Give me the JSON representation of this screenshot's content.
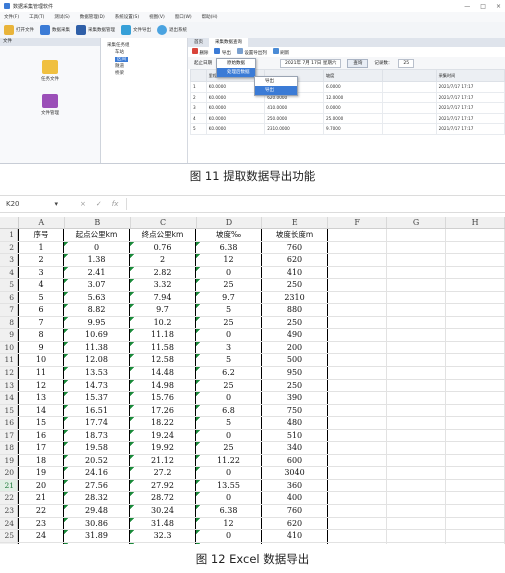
{
  "fig11": {
    "window_title": "数据采集管理软件",
    "window_controls": [
      "—",
      "□",
      "×"
    ],
    "menu": [
      "文件(F)",
      "工具(T)",
      "测试(S)",
      "数据管理(D)",
      "系统设置(S)",
      "视图(V)",
      "窗口(W)",
      "帮助(H)"
    ],
    "toolbar": [
      "打开文件",
      "数据采集",
      "采集数据管理",
      "文件导出",
      "退出系统"
    ],
    "left_panel_title": "文件",
    "left_items": [
      "任务文件",
      "文件管理"
    ],
    "tree": [
      "采集任务组",
      "车站",
      "区间",
      "隧道",
      "桥梁"
    ],
    "tabs": [
      "首页",
      "采集数据查询"
    ],
    "main_tools": [
      "删除",
      "导出",
      "设置导出列",
      "刷新"
    ],
    "filter": {
      "label": "起止日期",
      "date_to": "2021年 7月 17日 星期六",
      "query": "查询",
      "page_label": "记录数：",
      "page_value": "25"
    },
    "grid_columns": [
      "",
      "里程",
      "",
      "坡度",
      "",
      "采集时间"
    ],
    "grid_rows": [
      [
        "1",
        "K0.0000",
        "",
        "6.0000",
        "",
        "2021/7/17 17:17"
      ],
      [
        "2",
        "K0.0000",
        "620.0000",
        "12.0000",
        "",
        "2021/7/17 17:17"
      ],
      [
        "3",
        "K0.0000",
        "410.0000",
        "0.0000",
        "",
        "2021/7/17 17:17"
      ],
      [
        "4",
        "K0.0000",
        "250.0000",
        "25.0000",
        "",
        "2021/7/17 17:17"
      ],
      [
        "5",
        "K0.0000",
        "2310.0000",
        "9.7000",
        "",
        "2021/7/17 17:17"
      ]
    ],
    "context_menu": [
      "原始数据",
      "处理后数据"
    ],
    "submenu": [
      "导出",
      "导出"
    ],
    "caption": "图 11    提取数据导出功能"
  },
  "fig12": {
    "name_box": "K20",
    "fx": [
      "×",
      "✓",
      "fx"
    ],
    "columns": [
      "A",
      "B",
      "C",
      "D",
      "E",
      "F",
      "G",
      "H"
    ],
    "headers": [
      "序号",
      "起点公里km",
      "终点公里km",
      "坡度‰",
      "坡度长度m"
    ],
    "rows": [
      [
        "1",
        "0",
        "0.76",
        "6.38",
        "760"
      ],
      [
        "2",
        "1.38",
        "2",
        "12",
        "620"
      ],
      [
        "3",
        "2.41",
        "2.82",
        "0",
        "410"
      ],
      [
        "4",
        "3.07",
        "3.32",
        "25",
        "250"
      ],
      [
        "5",
        "5.63",
        "7.94",
        "9.7",
        "2310"
      ],
      [
        "6",
        "8.82",
        "9.7",
        "5",
        "880"
      ],
      [
        "7",
        "9.95",
        "10.2",
        "25",
        "250"
      ],
      [
        "8",
        "10.69",
        "11.18",
        "0",
        "490"
      ],
      [
        "9",
        "11.38",
        "11.58",
        "3",
        "200"
      ],
      [
        "10",
        "12.08",
        "12.58",
        "5",
        "500"
      ],
      [
        "11",
        "13.53",
        "14.48",
        "6.2",
        "950"
      ],
      [
        "12",
        "14.73",
        "14.98",
        "25",
        "250"
      ],
      [
        "13",
        "15.37",
        "15.76",
        "0",
        "390"
      ],
      [
        "14",
        "16.51",
        "17.26",
        "6.8",
        "750"
      ],
      [
        "15",
        "17.74",
        "18.22",
        "5",
        "480"
      ],
      [
        "16",
        "18.73",
        "19.24",
        "0",
        "510"
      ],
      [
        "17",
        "19.58",
        "19.92",
        "25",
        "340"
      ],
      [
        "18",
        "20.52",
        "21.12",
        "11.22",
        "600"
      ],
      [
        "19",
        "24.16",
        "27.2",
        "0",
        "3040"
      ],
      [
        "20",
        "27.56",
        "27.92",
        "13.55",
        "360"
      ],
      [
        "21",
        "28.32",
        "28.72",
        "0",
        "400"
      ],
      [
        "22",
        "29.48",
        "30.24",
        "6.38",
        "760"
      ],
      [
        "23",
        "30.86",
        "31.48",
        "12",
        "620"
      ],
      [
        "24",
        "31.89",
        "32.3",
        "0",
        "410"
      ],
      [
        "25",
        "32.55",
        "32.8",
        "25",
        "250"
      ]
    ],
    "selected_row": "20",
    "caption": "图 12    Excel 数据导出"
  }
}
